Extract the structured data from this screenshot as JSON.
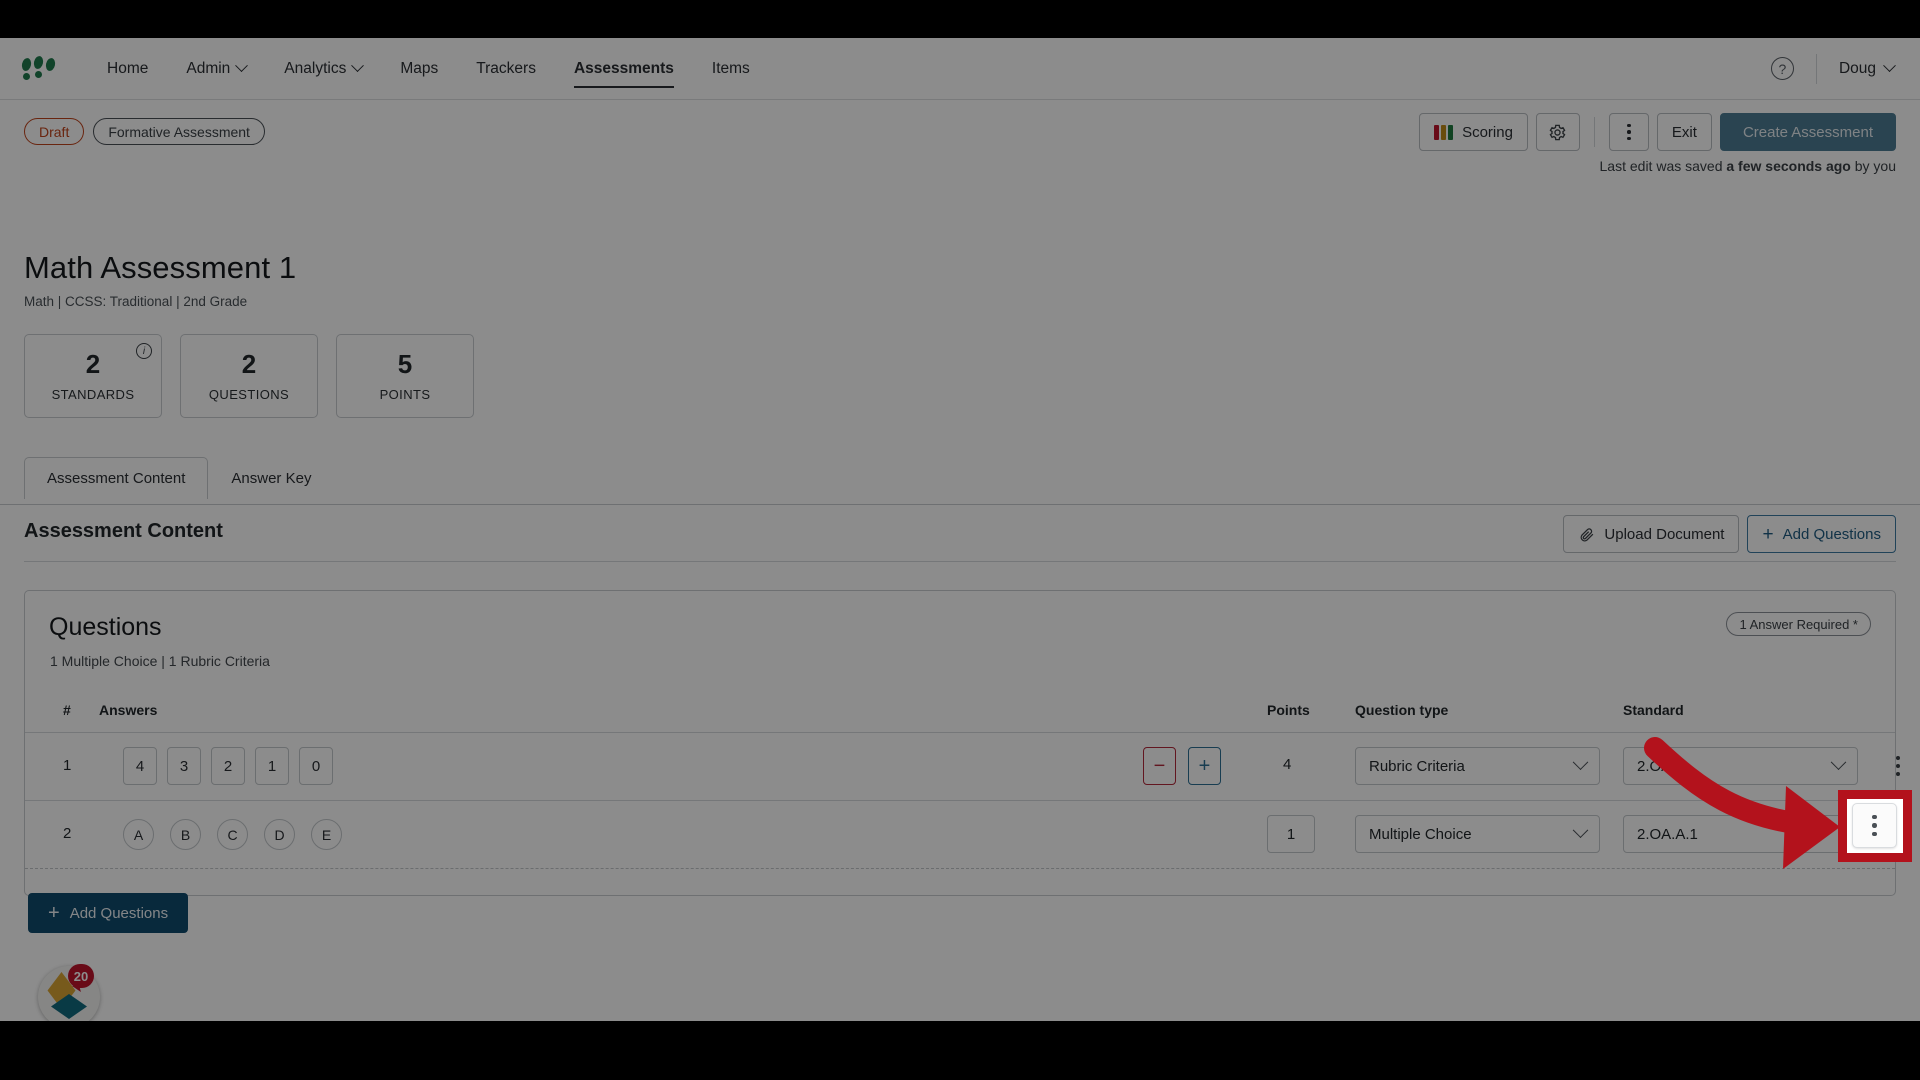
{
  "nav": {
    "brand_icon": "dots-logo-icon",
    "items": [
      {
        "label": "Home",
        "has_caret": false,
        "active": false
      },
      {
        "label": "Admin",
        "has_caret": true,
        "active": false
      },
      {
        "label": "Analytics",
        "has_caret": true,
        "active": false
      },
      {
        "label": "Maps",
        "has_caret": false,
        "active": false
      },
      {
        "label": "Trackers",
        "has_caret": false,
        "active": false
      },
      {
        "label": "Assessments",
        "has_caret": false,
        "active": true
      },
      {
        "label": "Items",
        "has_caret": false,
        "active": false
      }
    ],
    "help_icon": "question-mark-circle-icon",
    "help_glyph": "?",
    "user": "Doug"
  },
  "header": {
    "status_pill": "Draft",
    "type_pill": "Formative Assessment",
    "scoring_label": "Scoring",
    "scoring_colors": [
      "#c0142c",
      "#c08b16",
      "#1f7a3f"
    ],
    "settings_icon": "gear-icon",
    "more_icon": "kebab-menu-icon",
    "exit_label": "Exit",
    "create_label": "Create Assessment",
    "last_edit_prefix": "Last edit was saved ",
    "last_edit_bold": "a few seconds ago",
    "last_edit_suffix": " by you"
  },
  "title": {
    "name": "Math Assessment 1",
    "meta": "Math  |  CCSS: Traditional  |  2nd Grade"
  },
  "stats": [
    {
      "value": "2",
      "label": "STANDARDS",
      "info_icon": "info-circle-icon",
      "has_info": true
    },
    {
      "value": "2",
      "label": "QUESTIONS",
      "has_info": false
    },
    {
      "value": "5",
      "label": "POINTS",
      "has_info": false
    }
  ],
  "tabs": [
    {
      "label": "Assessment Content",
      "active": true
    },
    {
      "label": "Answer Key",
      "active": false
    }
  ],
  "content": {
    "heading": "Assessment Content",
    "upload_label": "Upload Document",
    "upload_icon": "paperclip-icon",
    "add_questions_label": "Add Questions",
    "add_icon": "plus-icon"
  },
  "questions": {
    "title": "Questions",
    "subtitle": "1 Multiple Choice | 1 Rubric Criteria",
    "required_badge": "1 Answer Required *",
    "columns": {
      "num": "#",
      "answers": "Answers",
      "points": "Points",
      "question_type": "Question type",
      "standard": "Standard"
    },
    "rows": [
      {
        "num": "1",
        "answer_style": "square",
        "answers": [
          "4",
          "3",
          "2",
          "1",
          "0"
        ],
        "has_stepper": true,
        "minus_glyph": "−",
        "plus_glyph": "+",
        "points": "4",
        "points_editable": false,
        "question_type": "Rubric Criteria",
        "standard": "2.OA.B.",
        "standard_has_caret": true,
        "row_menu_icon": "kebab-menu-icon"
      },
      {
        "num": "2",
        "answer_style": "circle",
        "answers": [
          "A",
          "B",
          "C",
          "D",
          "E"
        ],
        "has_stepper": false,
        "points": "1",
        "points_editable": true,
        "question_type": "Multiple Choice",
        "standard": "2.OA.A.1",
        "standard_has_caret": false,
        "row_menu_icon": "kebab-menu-icon"
      }
    ],
    "add_questions_label": "Add Questions",
    "add_icon": "plus-icon"
  },
  "fab": {
    "icon": "achievement-badge-icon",
    "count": "20"
  },
  "annotation": {
    "arrow_color": "#b3121c",
    "highlight_target": "row-2-kebab-menu"
  }
}
